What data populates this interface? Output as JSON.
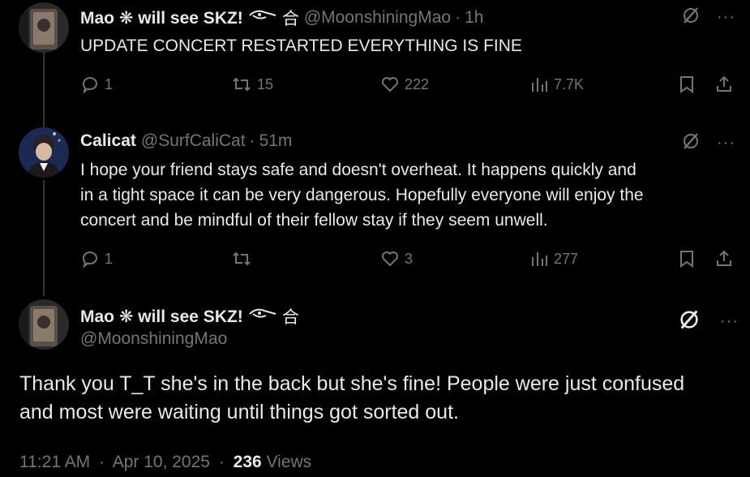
{
  "tweets": [
    {
      "display_name": "Mao ❋ will see SKZ!",
      "handle": "@MoonshiningMao",
      "time": "1h",
      "text": "UPDATE CONCERT RESTARTED EVERYTHING IS FINE",
      "replies": "1",
      "retweets": "15",
      "likes": "222",
      "views": "7.7K"
    },
    {
      "display_name": "Calicat",
      "handle": "@SurfCaliCat",
      "time": "51m",
      "text_lines": [
        "I hope your friend stays safe and doesn't overheat.  It happens quickly and",
        "in a tight space it can be very dangerous.  Hopefully everyone will enjoy the",
        "concert and be mindful of their fellow stay if they seem unwell."
      ],
      "replies": "1",
      "retweets": "",
      "likes": "3",
      "views": "277"
    }
  ],
  "main_tweet": {
    "display_name": "Mao ❋ will see SKZ!",
    "handle": "@MoonshiningMao",
    "text_lines": [
      "Thank you T_T she's in the back but she's fine! People were just confused",
      "and most were waiting until things got sorted out."
    ],
    "time": "11:21 AM",
    "date": "Apr 10, 2025",
    "views_count": "236",
    "views_label": "Views"
  },
  "symbols": {
    "separator": "·",
    "kanji": "合",
    "more": "···"
  },
  "colors": {
    "background": "#000000",
    "text": "#e7e9ea",
    "muted": "#71767b",
    "thread_line": "#333639"
  }
}
